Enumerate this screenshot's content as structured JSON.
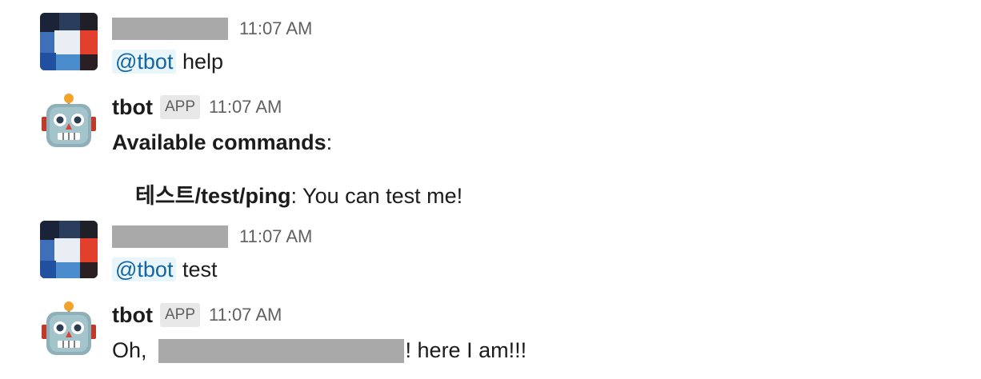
{
  "messages": [
    {
      "kind": "user",
      "timestamp": "11:07 AM",
      "mention": "@tbot",
      "text": "help"
    },
    {
      "kind": "bot",
      "name": "tbot",
      "badge": "APP",
      "timestamp": "11:07 AM",
      "heading": "Available commands",
      "heading_suffix": ":",
      "command": "테스트/test/ping",
      "command_desc": ": You can test me!"
    },
    {
      "kind": "user",
      "timestamp": "11:07 AM",
      "mention": "@tbot",
      "text": "test"
    },
    {
      "kind": "bot",
      "name": "tbot",
      "badge": "APP",
      "timestamp": "11:07 AM",
      "prefix": "Oh,",
      "suffix": "! here I am!!!"
    }
  ],
  "colors": {
    "mention_text": "#1264a3",
    "mention_bg": "#e8f5fa",
    "redaction": "#a9a9a9",
    "timestamp": "#616061"
  },
  "icons": {
    "user_avatar": "slack-grid-avatar-icon",
    "bot_avatar": "robot-face-icon"
  }
}
